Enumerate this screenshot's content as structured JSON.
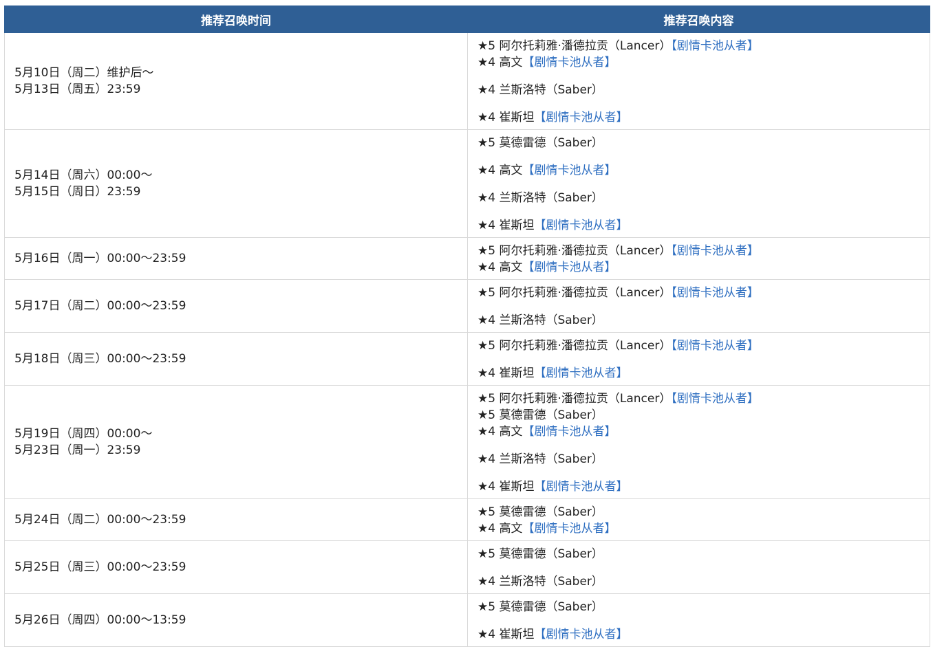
{
  "header": {
    "col_time": "推荐召唤时间",
    "col_content": "推荐召唤内容"
  },
  "rows": [
    {
      "time": [
        "5月10日（周二）维护后～",
        "5月13日（周五）23:59"
      ],
      "items": [
        {
          "text": "★5 阿尔托莉雅·潘德拉贡（Lancer）",
          "tag": "【剧情卡池从者】",
          "gap": false
        },
        {
          "text": "★4 高文",
          "tag": "【剧情卡池从者】",
          "gap": false
        },
        {
          "text": "★4 兰斯洛特（Saber）",
          "tag": "",
          "gap": true
        },
        {
          "text": "★4 崔斯坦",
          "tag": "【剧情卡池从者】",
          "gap": true
        }
      ]
    },
    {
      "time": [
        "5月14日（周六）00:00～",
        "5月15日（周日）23:59"
      ],
      "items": [
        {
          "text": "★5 莫德雷德（Saber）",
          "tag": "",
          "gap": false
        },
        {
          "text": "★4 高文",
          "tag": "【剧情卡池从者】",
          "gap": true
        },
        {
          "text": "★4 兰斯洛特（Saber）",
          "tag": "",
          "gap": true
        },
        {
          "text": "★4 崔斯坦",
          "tag": "【剧情卡池从者】",
          "gap": true
        }
      ]
    },
    {
      "time": [
        "5月16日（周一）00:00～23:59"
      ],
      "items": [
        {
          "text": "★5 阿尔托莉雅·潘德拉贡（Lancer）",
          "tag": "【剧情卡池从者】",
          "gap": false
        },
        {
          "text": "★4 高文",
          "tag": "【剧情卡池从者】",
          "gap": false
        }
      ]
    },
    {
      "time": [
        "5月17日（周二）00:00～23:59"
      ],
      "items": [
        {
          "text": "★5 阿尔托莉雅·潘德拉贡（Lancer）",
          "tag": "【剧情卡池从者】",
          "gap": false
        },
        {
          "text": "★4 兰斯洛特（Saber）",
          "tag": "",
          "gap": true
        }
      ]
    },
    {
      "time": [
        "5月18日（周三）00:00～23:59"
      ],
      "items": [
        {
          "text": "★5 阿尔托莉雅·潘德拉贡（Lancer）",
          "tag": "【剧情卡池从者】",
          "gap": false
        },
        {
          "text": "★4 崔斯坦",
          "tag": "【剧情卡池从者】",
          "gap": true
        }
      ]
    },
    {
      "time": [
        "5月19日（周四）00:00～",
        "5月23日（周一）23:59"
      ],
      "items": [
        {
          "text": "★5 阿尔托莉雅·潘德拉贡（Lancer）",
          "tag": "【剧情卡池从者】",
          "gap": false
        },
        {
          "text": "★5 莫德雷德（Saber）",
          "tag": "",
          "gap": false
        },
        {
          "text": "★4 高文",
          "tag": "【剧情卡池从者】",
          "gap": false
        },
        {
          "text": "★4 兰斯洛特（Saber）",
          "tag": "",
          "gap": true
        },
        {
          "text": "★4 崔斯坦",
          "tag": "【剧情卡池从者】",
          "gap": true
        }
      ]
    },
    {
      "time": [
        "5月24日（周二）00:00～23:59"
      ],
      "items": [
        {
          "text": "★5 莫德雷德（Saber）",
          "tag": "",
          "gap": false
        },
        {
          "text": "★4 高文",
          "tag": "【剧情卡池从者】",
          "gap": false
        }
      ]
    },
    {
      "time": [
        "5月25日（周三）00:00～23:59"
      ],
      "items": [
        {
          "text": "★5 莫德雷德（Saber）",
          "tag": "",
          "gap": false
        },
        {
          "text": "★4 兰斯洛特（Saber）",
          "tag": "",
          "gap": true
        }
      ]
    },
    {
      "time": [
        "5月26日（周四）00:00～13:59"
      ],
      "items": [
        {
          "text": "★5 莫德雷德（Saber）",
          "tag": "",
          "gap": false
        },
        {
          "text": "★4 崔斯坦",
          "tag": "【剧情卡池从者】",
          "gap": true
        }
      ]
    }
  ]
}
